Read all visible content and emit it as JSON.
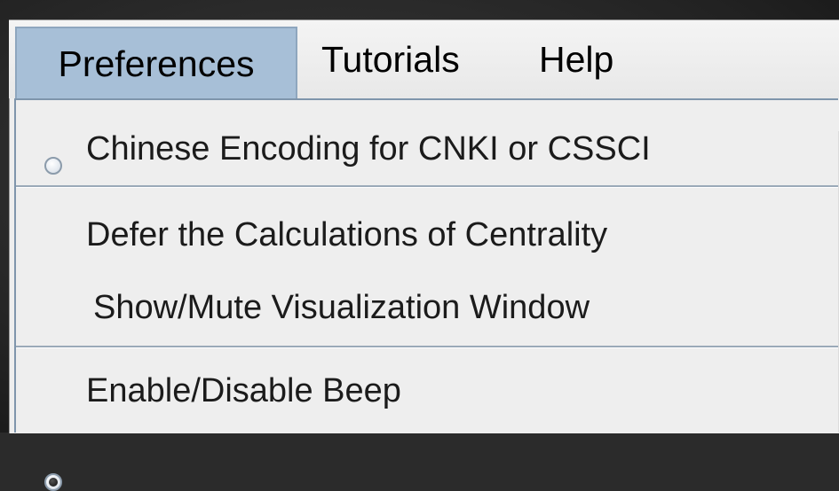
{
  "menubar": {
    "items": [
      {
        "label": "Preferences",
        "active": true
      },
      {
        "label": "Tutorials",
        "active": false
      },
      {
        "label": "Help",
        "active": false
      }
    ]
  },
  "preferences_menu": {
    "items": [
      {
        "label": "Chinese Encoding for CNKI or CSSCI",
        "type": "radio",
        "selected": false
      },
      {
        "label": "Defer the Calculations of Centrality",
        "type": "item"
      },
      {
        "label": "Show/Mute Visualization Window",
        "type": "radio",
        "selected": true
      },
      {
        "label": "Enable/Disable Beep",
        "type": "item"
      }
    ]
  },
  "colors": {
    "menu_background": "#eeeeee",
    "active_menu_highlight": "#a7bfd7",
    "popup_border": "#7f95ab",
    "backdrop": "#2b2b2b"
  }
}
